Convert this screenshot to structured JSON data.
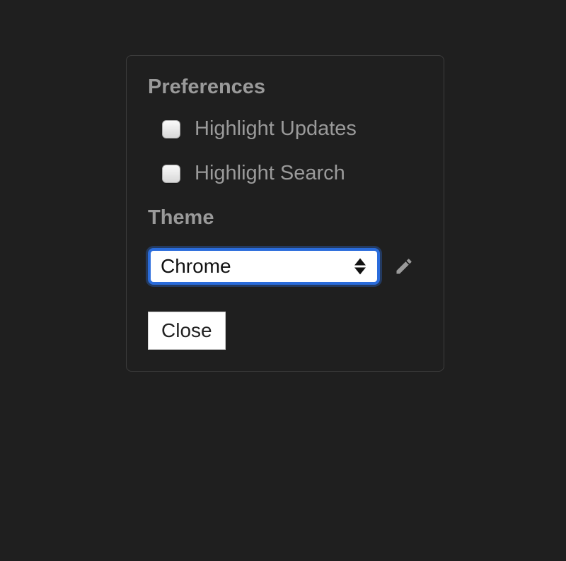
{
  "panel": {
    "sections": {
      "preferences": {
        "title": "Preferences",
        "options": [
          {
            "label": "Highlight Updates",
            "checked": false
          },
          {
            "label": "Highlight Search",
            "checked": false
          }
        ]
      },
      "theme": {
        "title": "Theme",
        "selected": "Chrome"
      }
    },
    "close_label": "Close"
  },
  "icons": {
    "edit": "pencil-icon"
  }
}
